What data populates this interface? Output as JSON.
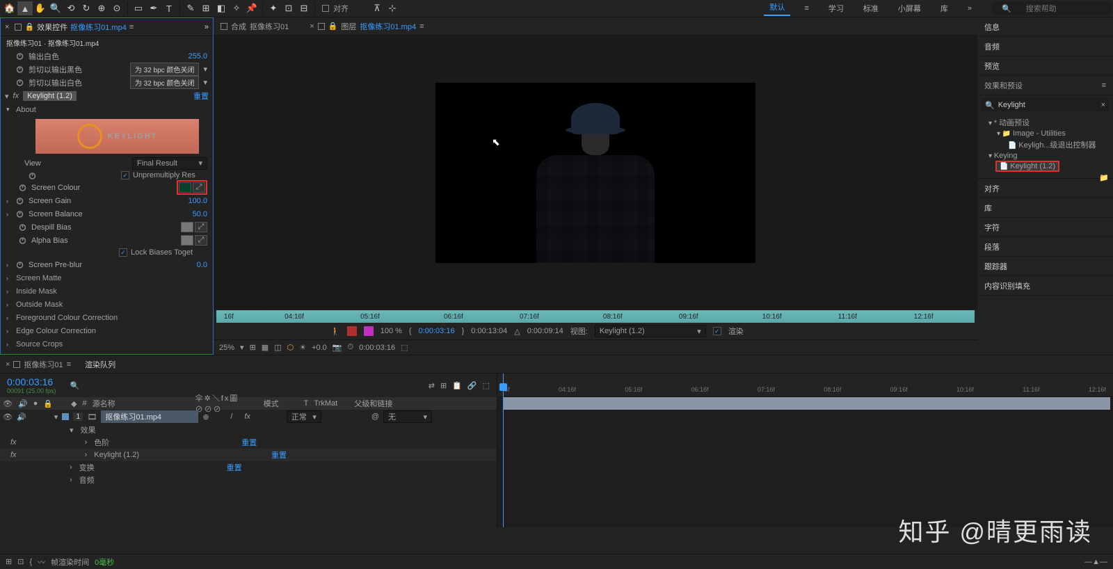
{
  "toolbar": {
    "align_label": "对齐"
  },
  "workspaces": {
    "items": [
      "默认",
      "学习",
      "标准",
      "小屏幕",
      "库"
    ],
    "active": 0,
    "search_placeholder": "搜索帮助"
  },
  "effects_panel": {
    "tab_prefix": "效果控件",
    "filename": "抠像练习01.mp4",
    "breadcrumb": "抠像练习01 · 抠像练习01.mp4",
    "output_white": {
      "label": "输出白色",
      "value": "255.0"
    },
    "clip_black": {
      "label": "剪切以输出黑色",
      "btn": "为 32 bpc 颜色关闭"
    },
    "clip_white": {
      "label": "剪切以输出白色",
      "btn": "为 32 bpc 颜色关闭"
    },
    "fx": {
      "name": "Keylight (1.2)",
      "reset": "重置",
      "about": "About",
      "logo": "KEYLIGHT",
      "view": {
        "label": "View",
        "value": "Final Result"
      },
      "unpremult": "Unpremultiply Res",
      "screen_colour": "Screen Colour",
      "screen_gain": {
        "label": "Screen Gain",
        "value": "100.0"
      },
      "screen_balance": {
        "label": "Screen Balance",
        "value": "50.0"
      },
      "despill": "Despill Bias",
      "alpha_bias": "Alpha Bias",
      "lock_biases": "Lock Biases Toget",
      "screen_preblur": {
        "label": "Screen Pre-blur",
        "value": "0.0"
      },
      "groups": [
        "Screen Matte",
        "Inside Mask",
        "Outside Mask",
        "Foreground Colour Correction",
        "Edge Colour Correction",
        "Source Crops"
      ]
    }
  },
  "viewer": {
    "tabs": {
      "comp": {
        "prefix": "合成",
        "name": "抠像练习01"
      },
      "layer": {
        "prefix": "图层",
        "name": "抠像练习01.mp4"
      }
    },
    "ruler_ticks": [
      "16f",
      "04:16f",
      "05:16f",
      "06:16f",
      "07:16f",
      "08:16f",
      "09:16f",
      "10:16f",
      "11:16f",
      "12:16f"
    ],
    "controls": {
      "pct": "100 %",
      "tc1": "0:00:03:16",
      "tc2": "0:00:13:04",
      "tc3": "0:00:09:14",
      "view_label": "视图:",
      "view_value": "Keylight (1.2)",
      "render": "渲染"
    },
    "status": {
      "zoom": "25%",
      "plus": "+0.0",
      "tc": "0:00:03:16"
    }
  },
  "right": {
    "panels": [
      "信息",
      "音频",
      "预览"
    ],
    "effects_presets": "效果和预设",
    "search_value": "Keylight",
    "tree": {
      "anim_presets": "* 动画预设",
      "image_util": "Image - Utilities",
      "kl_controller": "Keyligh...级退出控制器",
      "keying": "Keying",
      "kl12": "Keylight (1.2)"
    },
    "lower_panels": [
      "对齐",
      "库",
      "字符",
      "段落",
      "跟踪器",
      "内容识别填充"
    ]
  },
  "timeline": {
    "tab1": "抠像练习01",
    "tab2": "渲染队列",
    "timecode": "0:00:03:16",
    "frameinfo": "00091 (25.00 fps)",
    "cols": {
      "source": "源名称",
      "switches": "伞✲＼fx圖⊘⊘⊘",
      "mode": "模式",
      "trkmat_t": "T",
      "trkmat": "TrkMat",
      "parent": "父级和链接"
    },
    "layer": {
      "num": "1",
      "name": "抠像练习01.mp4",
      "mode": "正常",
      "parent": "无"
    },
    "subs": {
      "effects": "效果",
      "levels": {
        "name": "色阶",
        "reset": "重置"
      },
      "keylight": {
        "name": "Keylight (1.2)",
        "reset": "重置"
      },
      "transform": {
        "name": "变换",
        "reset": "重置"
      },
      "audio": "音频"
    },
    "ruler_ticks": [
      "5f",
      "04:16f",
      "05:16f",
      "06:16f",
      "07:16f",
      "08:16f",
      "09:16f",
      "10:16f",
      "11:16f",
      "12:16f"
    ]
  },
  "statusbar": {
    "label": "帧渲染时间",
    "value": "0毫秒"
  },
  "watermark": "知乎 @晴更雨读"
}
